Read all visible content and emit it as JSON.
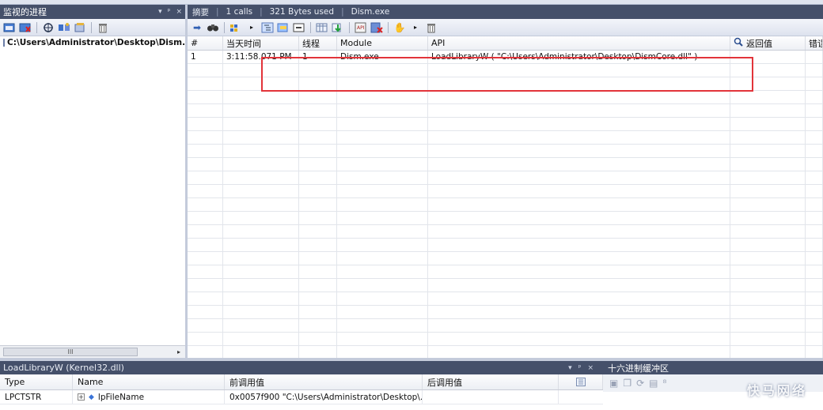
{
  "left_pane": {
    "title": "监视的进程",
    "title_buttons": [
      "▾",
      "ᵖ",
      "×"
    ],
    "toolbar_icons": [
      "attach-icon",
      "detach-icon",
      "target-icon",
      "process-icon",
      "properties-icon",
      "trash-icon"
    ],
    "process_path": "C:\\Users\\Administrator\\Desktop\\Dism.exe",
    "scrollbar_grip": "III"
  },
  "summary": {
    "label": "摘要",
    "calls": "1 calls",
    "bytes": "321 Bytes used",
    "process": "Dism.exe"
  },
  "grid": {
    "columns": [
      "#",
      "当天时间",
      "线程",
      "Module",
      "API",
      "返回值",
      "错误"
    ],
    "rows": [
      {
        "num": "1",
        "time": "3:11:58.071 PM",
        "thread": "1",
        "module": "Dism.exe",
        "api": "LoadLibraryW ( \"C:\\Users\\Administrator\\Desktop\\DismCore.dll\" )",
        "ret": "",
        "err": ""
      }
    ],
    "empty_rows": 22
  },
  "params_pane": {
    "title": "LoadLibraryW (Kernel32.dll)",
    "title_buttons": [
      "▾",
      "ᵖ",
      "×"
    ],
    "columns": [
      "Type",
      "Name",
      "前调用值",
      "后调用值"
    ],
    "rows": [
      {
        "type": "LPCTSTR",
        "name": "lpFileName",
        "pre": "0x0057f900 \"C:\\Users\\Administrator\\Desktop\\...",
        "post": ""
      }
    ]
  },
  "hex_pane": {
    "title": "十六进制缓冲区",
    "watermark": "快马网络"
  },
  "colors": {
    "title_bar": "#45506a",
    "highlight": "#e2343a",
    "background": "#d6dbe9"
  }
}
